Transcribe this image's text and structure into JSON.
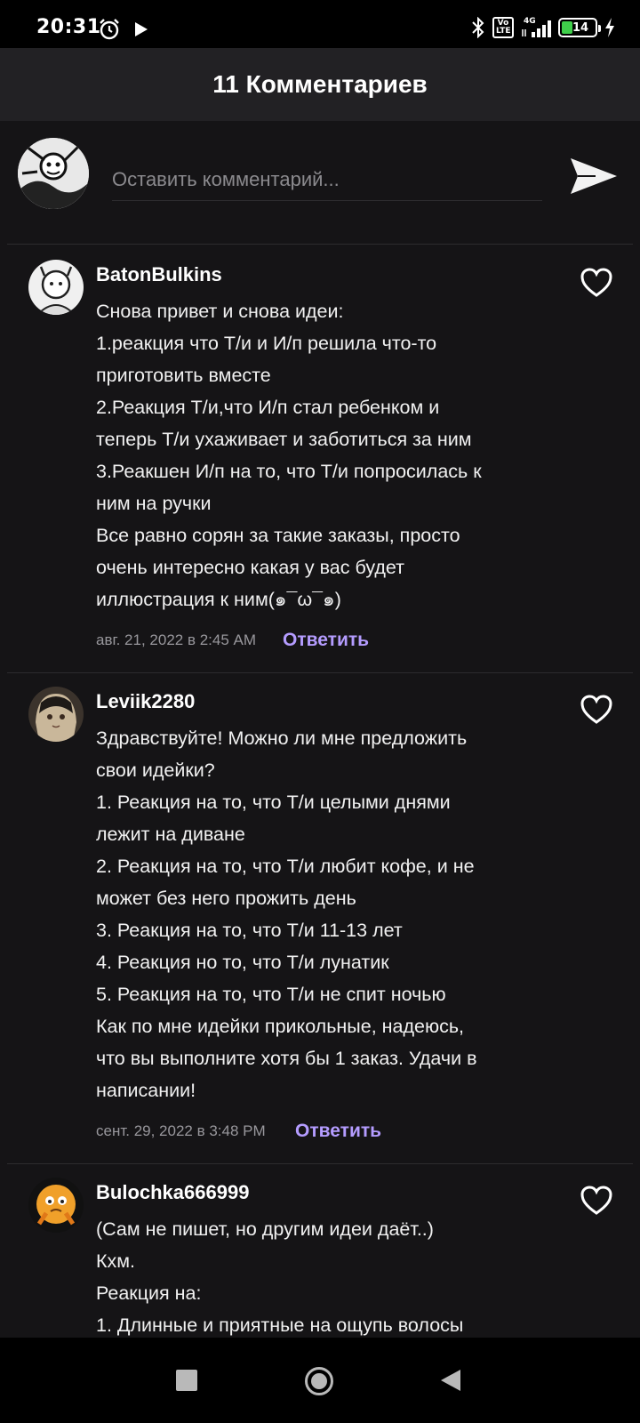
{
  "status_bar": {
    "time": "20:31",
    "network_label": "4G",
    "volte_label": "Vo LTE",
    "battery": "14"
  },
  "header": {
    "title": "11 Комментариев"
  },
  "composer": {
    "placeholder": "Оставить комментарий..."
  },
  "comments": [
    {
      "username": "BatonBulkins",
      "lines": [
        "Снова привет и снова идеи:",
        "1.реакция что Т/и и И/п решила что-то",
        "приготовить вместе",
        "2.Реакция Т/и,что И/п стал ребенком и",
        "теперь Т/и ухаживает и заботиться за ним",
        "3.Реакшен И/п на то, что Т/и попросилась к",
        "ним на ручки",
        "Все равно сорян за такие заказы, просто",
        "очень интересно какая у вас будет",
        "иллюстрация к ним(๑¯ω¯๑)"
      ],
      "date": "авг. 21, 2022 в 2:45 AM",
      "reply": "Ответить"
    },
    {
      "username": "Leviik2280",
      "lines": [
        "Здравствуйте! Можно ли мне предложить",
        "свои идейки?",
        "1. Реакция на то, что Т/и целыми днями",
        "лежит на диване",
        "2. Реакция на то, что Т/и любит кофе, и не",
        "может без него прожить день",
        "3. Реакция на то, что Т/и 11-13 лет",
        "4. Реакция но то, что Т/и лунатик",
        "5. Реакция на то, что Т/и не спит ночью",
        "Как по мне идейки прикольные, надеюсь,",
        "что вы выполните хотя бы 1 заказ. Удачи в",
        "написании!"
      ],
      "date": "сент. 29, 2022 в 3:48 PM",
      "reply": "Ответить"
    },
    {
      "username": "Bulochka666999",
      "lines": [
        "(Сам не пишет, но другим идеи даёт..)",
        "Кхм.",
        "Реакция на:",
        "1. Длинные и приятные на ощупь волосы"
      ]
    }
  ],
  "colors": {
    "background": "#151416",
    "header": "#222124",
    "reply": "#b49cff",
    "battery_fill": "#3fcf4a"
  },
  "icons": [
    "alarm-icon",
    "play-icon",
    "bluetooth-icon",
    "signal-icon",
    "battery-icon",
    "send-icon",
    "heart-icon",
    "nav-recents-icon",
    "nav-home-icon",
    "nav-back-icon"
  ]
}
